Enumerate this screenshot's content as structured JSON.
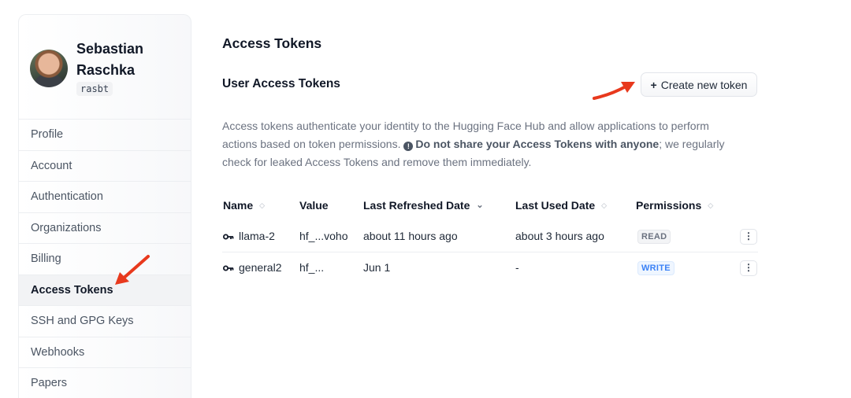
{
  "user": {
    "name": "Sebastian Raschka",
    "handle": "rasbt"
  },
  "nav": {
    "items": [
      {
        "label": "Profile"
      },
      {
        "label": "Account"
      },
      {
        "label": "Authentication"
      },
      {
        "label": "Organizations"
      },
      {
        "label": "Billing"
      },
      {
        "label": "Access Tokens",
        "active": true
      },
      {
        "label": "SSH and GPG Keys"
      },
      {
        "label": "Webhooks"
      },
      {
        "label": "Papers"
      }
    ]
  },
  "page": {
    "title": "Access Tokens",
    "section_title": "User Access Tokens",
    "create_button": "Create new token",
    "desc_part1": "Access tokens authenticate your identity to the Hugging Face Hub and allow applications to perform actions based on token permissions.",
    "desc_bold": "Do not share your Access Tokens with anyone",
    "desc_part2": "; we regularly check for leaked Access Tokens and remove them immediately."
  },
  "table": {
    "headers": {
      "name": "Name",
      "value": "Value",
      "last_refreshed": "Last Refreshed Date",
      "last_used": "Last Used Date",
      "permissions": "Permissions"
    },
    "rows": [
      {
        "name": "llama-2",
        "value": "hf_...voho",
        "last_refreshed": "about 11 hours ago",
        "last_used": "about 3 hours ago",
        "permission": "READ"
      },
      {
        "name": "general2",
        "value": "hf_...",
        "last_refreshed": "Jun 1",
        "last_used": "-",
        "permission": "WRITE"
      }
    ]
  },
  "colors": {
    "annotation_arrow": "#e8391d",
    "write_badge": "#3b82f6",
    "read_badge": "#6b7280"
  },
  "icons": [
    "key-icon",
    "more-vertical-icon",
    "plus-icon",
    "exclamation-circle-icon",
    "sort-icon"
  ]
}
